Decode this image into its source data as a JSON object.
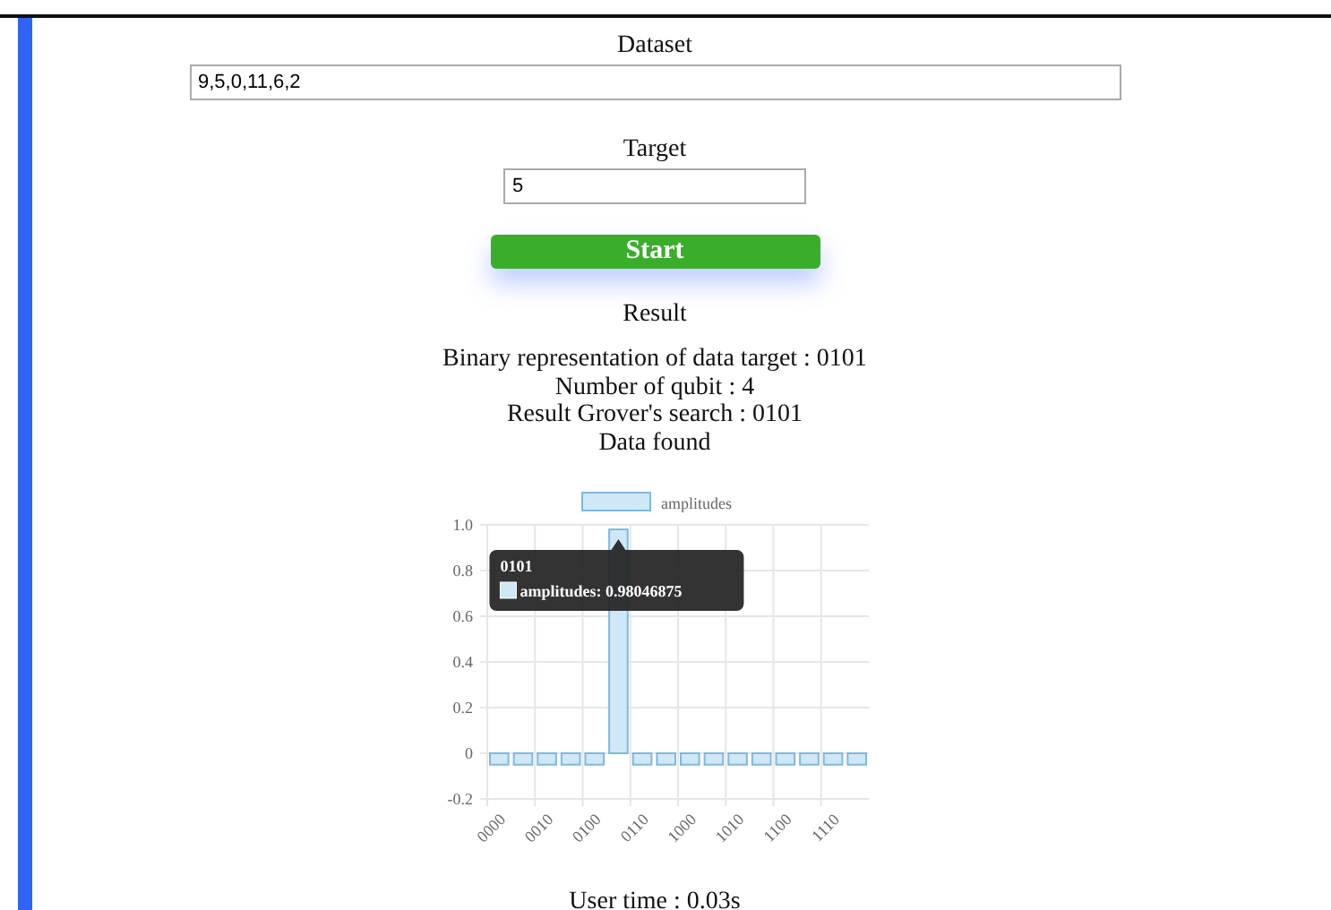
{
  "dataset": {
    "label": "Dataset",
    "value": "9,5,0,11,6,2"
  },
  "target": {
    "label": "Target",
    "value": "5"
  },
  "start_button": "Start",
  "result": {
    "heading": "Result",
    "lines": [
      "Binary representation of data target : 0101",
      "Number of qubit : 4",
      "Result Grover's search : 0101",
      "Data found"
    ]
  },
  "chart": {
    "chart_data": {
      "type": "bar",
      "categories": [
        "0000",
        null,
        "0010",
        null,
        "0100",
        null,
        "0110",
        null,
        "1000",
        null,
        "1010",
        null,
        "1100",
        null,
        "1110",
        null
      ],
      "grid": true,
      "series": [
        {
          "name": "amplitudes",
          "color": "#cfe8f8",
          "values": [
            -0.05,
            -0.05,
            -0.05,
            -0.05,
            -0.05,
            0.98,
            -0.05,
            -0.05,
            -0.05,
            -0.05,
            -0.05,
            -0.05,
            -0.05,
            -0.05,
            -0.05,
            -0.05
          ]
        }
      ],
      "ylim": [
        -0.2,
        1.0
      ],
      "yticks": [
        {
          "value": 1,
          "label": "1.0"
        },
        0.8,
        0.6,
        0.4,
        0.2,
        {
          "value": 0,
          "label": "0"
        },
        -0.2
      ]
    },
    "tooltip": {
      "title": "0101",
      "text": "amplitudes: 0.98046875"
    }
  },
  "user_time": "User time : 0.03s"
}
